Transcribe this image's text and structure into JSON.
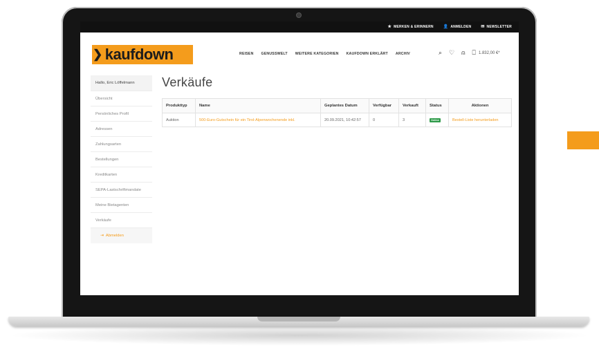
{
  "topbar": {
    "links": [
      {
        "label": "MERKEN & ERINNERN",
        "icon": "star-icon"
      },
      {
        "label": "ANMELDEN",
        "icon": "user-icon"
      },
      {
        "label": "NEWSLETTER",
        "icon": "mail-icon"
      }
    ]
  },
  "brand": {
    "name": "kaufdown",
    "color": "#f49c1c"
  },
  "nav": {
    "items": [
      "REISEN",
      "GENUSSWELT",
      "WEITERE KATEGORIEN",
      "KAUFDOWN ERKLÄRT",
      "ARCHIV"
    ],
    "cart_total": "1.832,00 €*"
  },
  "sidebar": {
    "greeting": "Hallo, Eric Löffelmann",
    "items": [
      "Übersicht",
      "Persönliches Profil",
      "Adressen",
      "Zahlungsarten",
      "Bestellungen",
      "Kreditkarten",
      "SEPA-Lastschriftmandate",
      "Meine Bietagenten",
      "Verkäufe"
    ],
    "logout": "Abmelden"
  },
  "main": {
    "title": "Verkäufe",
    "table": {
      "headers": [
        "Produkttyp",
        "Name",
        "Geplantes Datum",
        "Verfügbar",
        "Verkauft",
        "Status",
        "Aktionen"
      ],
      "rows": [
        {
          "type": "Auktion",
          "name": "500-Euro-Gutschein für ein Tirol-Alpenwochenende inkl.",
          "date": "20.09.2021, 10:42:57",
          "available": "0",
          "sold": "3",
          "status": "Online",
          "action": "Bestell-Liste herunterladen"
        }
      ]
    }
  },
  "colors": {
    "accent": "#f49c1c",
    "status_online": "#2e9a49"
  }
}
